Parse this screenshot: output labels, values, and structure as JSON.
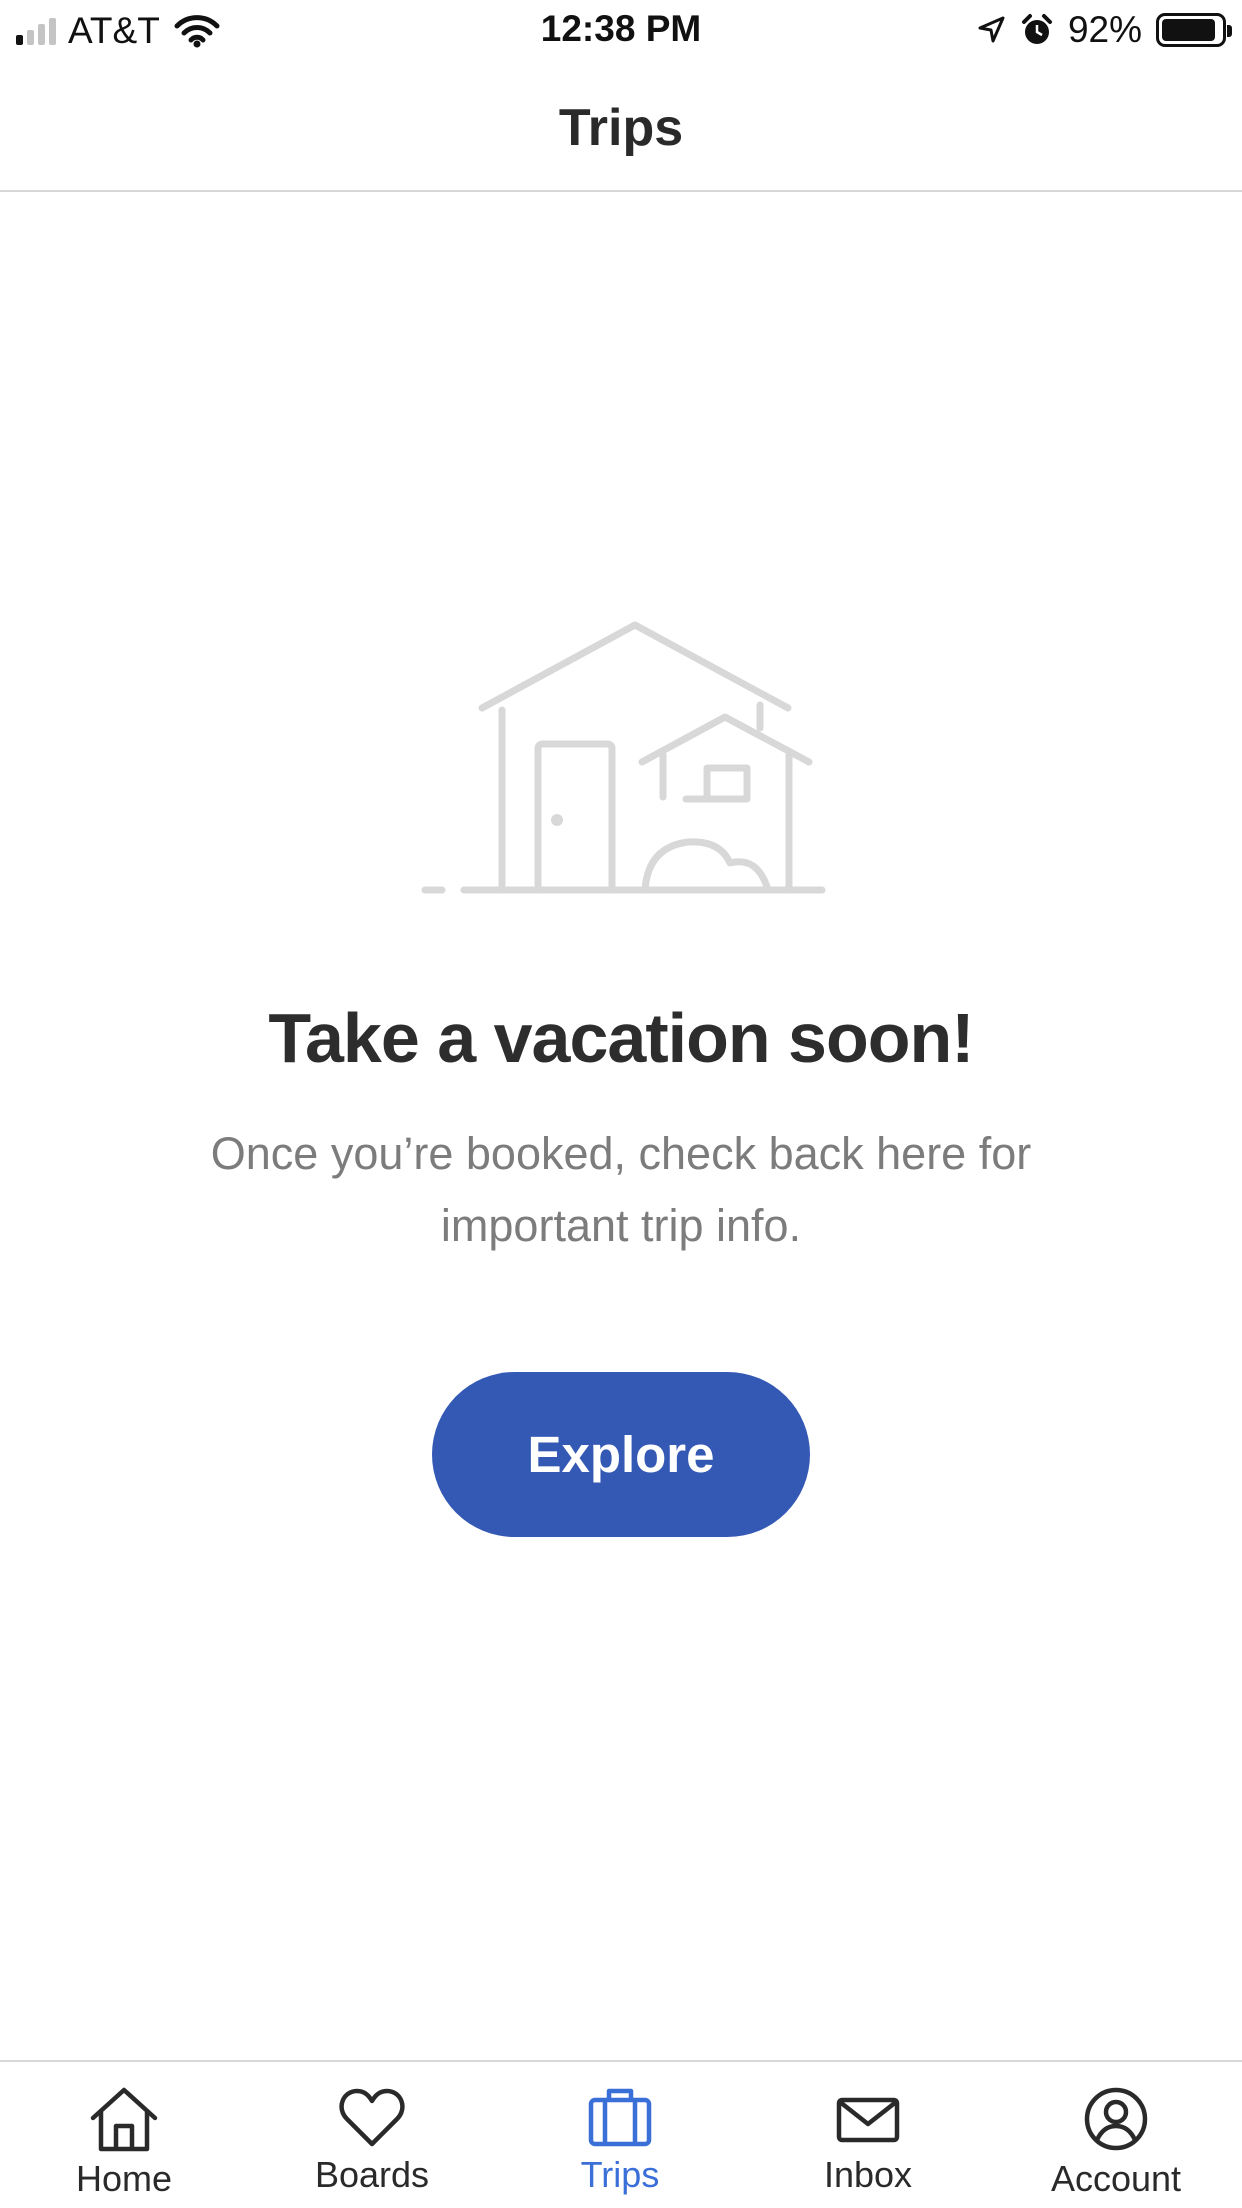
{
  "status_bar": {
    "carrier": "AT&T",
    "time": "12:38 PM",
    "battery_percent": "92%",
    "battery_level": 0.92,
    "signal_bars_filled": 1,
    "signal_bars_total": 4
  },
  "header": {
    "title": "Trips"
  },
  "empty_state": {
    "title": "Take a vacation soon!",
    "body": "Once you’re booked, check back here for important trip info.",
    "illustration_icon": "house-illustration-icon"
  },
  "explore_button": {
    "label": "Explore"
  },
  "tab_bar": {
    "tabs": [
      {
        "label": "Home",
        "icon": "home-icon",
        "active": false
      },
      {
        "label": "Boards",
        "icon": "heart-icon",
        "active": false
      },
      {
        "label": "Trips",
        "icon": "suitcase-icon",
        "active": true
      },
      {
        "label": "Inbox",
        "icon": "envelope-icon",
        "active": false
      },
      {
        "label": "Account",
        "icon": "user-circle-icon",
        "active": false
      }
    ]
  },
  "colors": {
    "accent": "#3459b5",
    "active_tab": "#3b6fd8",
    "illustration": "#d8d8d8",
    "body_text": "#7c7c7c",
    "title_text": "#2d2d2d"
  }
}
